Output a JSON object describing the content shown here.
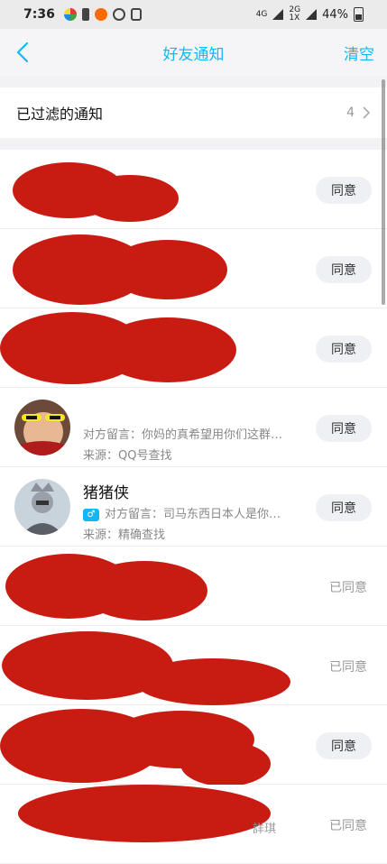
{
  "status_bar": {
    "time": "7:36",
    "network_a": "4G",
    "network_b": "2G\n1X",
    "battery": "44%"
  },
  "nav": {
    "title": "好友通知",
    "clear_label": "清空"
  },
  "filtered": {
    "label": "已过滤的通知",
    "count": "4"
  },
  "requests": [
    {
      "state": "pending",
      "action_label": "同意"
    },
    {
      "state": "pending",
      "action_label": "同意"
    },
    {
      "state": "pending",
      "action_label": "同意"
    },
    {
      "state": "pending",
      "message": "对方留言：你妈的真希望用你们这群…",
      "source": "来源：QQ号查找",
      "action_label": "同意"
    },
    {
      "state": "pending",
      "name": "猪猪侠",
      "gender_icon": "male",
      "message": "对方留言：司马东西日本人是你…",
      "source": "来源：精确查找",
      "action_label": "同意"
    },
    {
      "state": "accepted",
      "status_label": "已同意"
    },
    {
      "state": "accepted",
      "status_label": "已同意"
    },
    {
      "state": "pending",
      "action_label": "同意"
    },
    {
      "state": "accepted",
      "status_label": "已同意",
      "partial_text": "詳琪"
    }
  ],
  "colors": {
    "accent": "#12b7f5",
    "redaction": "#c81c12"
  }
}
